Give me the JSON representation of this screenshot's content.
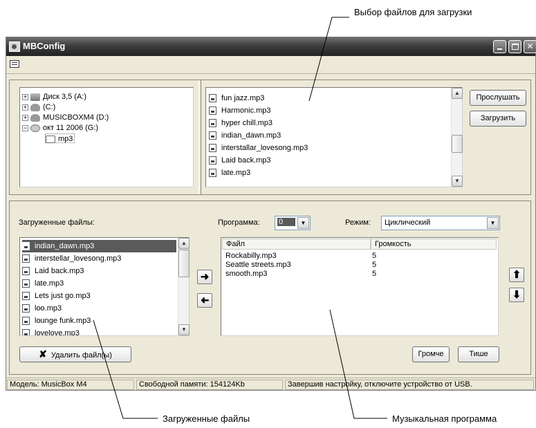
{
  "annotations": {
    "file_select": "Выбор файлов для загрузки",
    "loaded_files": "Загруженные файлы",
    "music_program": "Музыкальная программа"
  },
  "window": {
    "title": "MBConfig"
  },
  "tree": {
    "items": [
      {
        "label": "Диск 3,5 (A:)",
        "icon": "floppy-drive-icon"
      },
      {
        "label": "(C:)",
        "icon": "hard-disk-icon"
      },
      {
        "label": "MUSICBOXM4 (D:)",
        "icon": "hard-disk-icon"
      },
      {
        "label": "окт 11 2006 (G:)",
        "icon": "cd-drive-icon"
      },
      {
        "label": "mp3",
        "icon": "folder-icon"
      }
    ]
  },
  "source_files": [
    "fun jazz.mp3",
    "Harmonic.mp3",
    "hyper chill.mp3",
    "indian_dawn.mp3",
    "interstallar_lovesong.mp3",
    "Laid back.mp3",
    "late.mp3"
  ],
  "buttons": {
    "listen": "Прослушать",
    "upload": "Загрузить",
    "delete": "Удалить файл(ы)",
    "louder": "Громче",
    "quieter": "Тише"
  },
  "loaded": {
    "label": "Загруженные файлы:",
    "files": [
      "indian_dawn.mp3",
      "interstellar_lovesong.mp3",
      "Laid back.mp3",
      "late.mp3",
      "Lets just go.mp3",
      "loo.mp3",
      "lounge funk.mp3",
      "lovelove.mp3"
    ],
    "selected_index": 0
  },
  "program": {
    "label": "Программа:",
    "value": "0",
    "mode_label": "Режим:",
    "mode_value": "Циклический",
    "columns": [
      "Файл",
      "Громкость"
    ],
    "rows": [
      {
        "file": "Rockabilly.mp3",
        "volume": "5"
      },
      {
        "file": "Seattle streets.mp3",
        "volume": "5"
      },
      {
        "file": "smooth.mp3",
        "volume": "5"
      }
    ]
  },
  "status": {
    "model": "Модель: MusicBox M4",
    "memory": "Свободной памяти: 154124Kb",
    "hint": "Завершив настройку, отключите устройство от USB."
  }
}
